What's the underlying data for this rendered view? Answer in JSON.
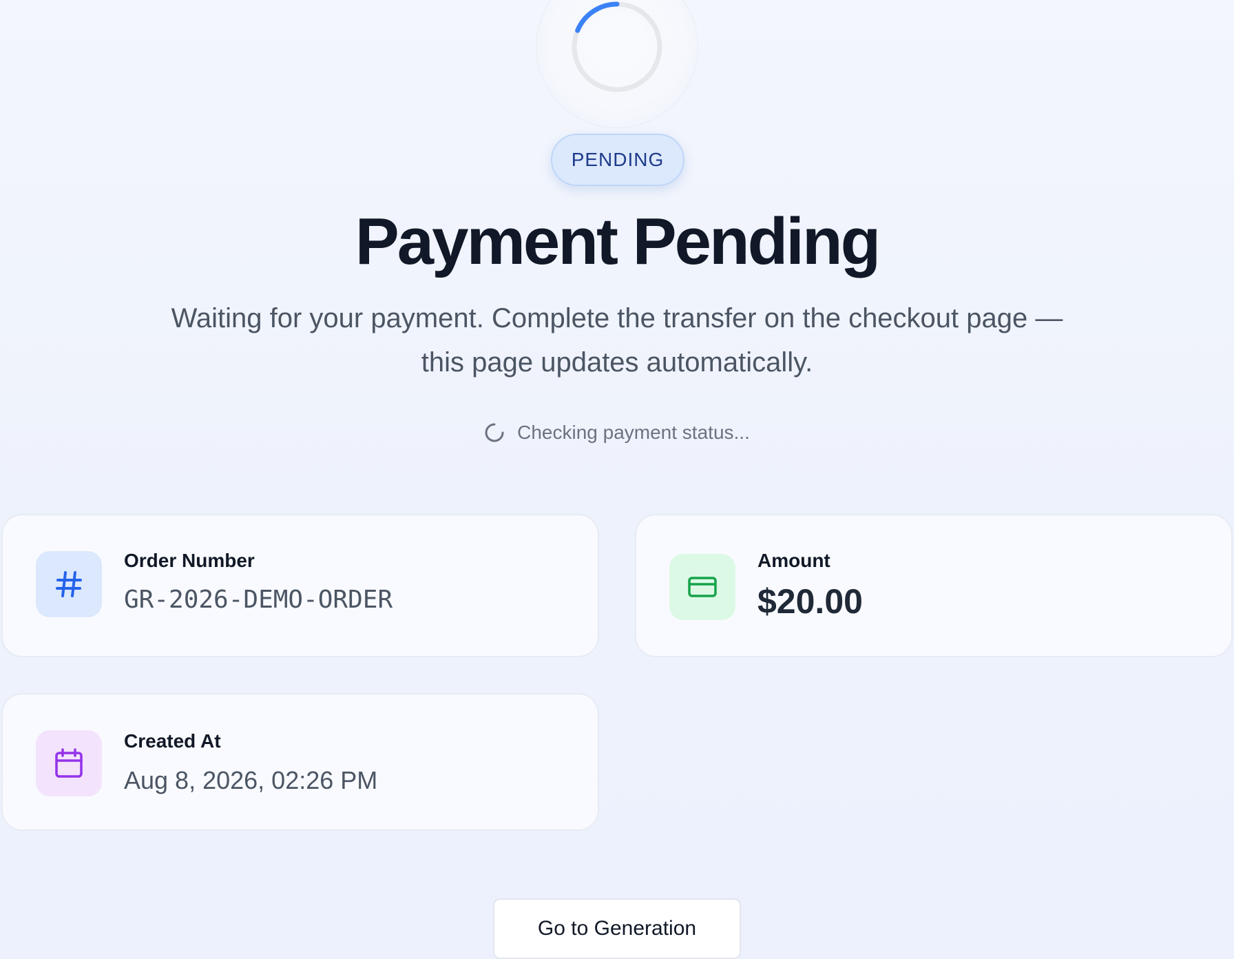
{
  "status": {
    "badge_label": "PENDING",
    "title": "Payment Pending",
    "description": "Waiting for your payment. Complete the transfer on the checkout page — this page updates automatically.",
    "checking_text": "Checking payment status..."
  },
  "cards": {
    "order": {
      "label": "Order Number",
      "value": "GR-2026-DEMO-ORDER",
      "icon": "hash-icon"
    },
    "amount": {
      "label": "Amount",
      "value": "$20.00",
      "icon": "credit-card-icon"
    },
    "created": {
      "label": "Created At",
      "value": "Aug 8, 2026, 02:26 PM",
      "icon": "calendar-icon"
    }
  },
  "actions": {
    "go_to_generation_label": "Go to Generation"
  },
  "colors": {
    "accent_blue": "#3b82f6",
    "badge_text": "#1e3a8a",
    "icon_blue": "#2563eb",
    "icon_green": "#16a34a",
    "icon_purple": "#9333ea"
  }
}
